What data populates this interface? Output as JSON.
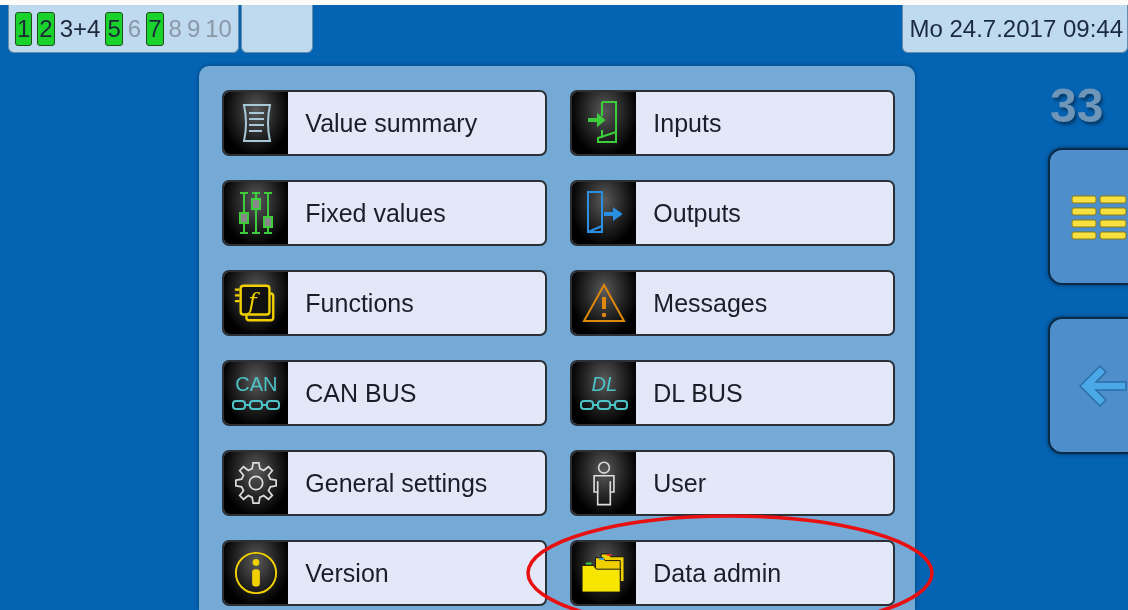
{
  "status_bar": {
    "channels": [
      {
        "label": "1",
        "active": true,
        "disabled": false
      },
      {
        "label": "2",
        "active": true,
        "disabled": false
      },
      {
        "label": "3+4",
        "active": false,
        "disabled": false
      },
      {
        "label": "5",
        "active": true,
        "disabled": false
      },
      {
        "label": "6",
        "active": false,
        "disabled": true
      },
      {
        "label": "7",
        "active": true,
        "disabled": false
      },
      {
        "label": "8",
        "active": false,
        "disabled": true
      },
      {
        "label": "9",
        "active": false,
        "disabled": true
      },
      {
        "label": "10",
        "active": false,
        "disabled": true
      }
    ],
    "datetime": "Mo 24.7.2017 09:44"
  },
  "menu": {
    "items": [
      {
        "label": "Value summary",
        "kind": "list",
        "highlighted": false
      },
      {
        "label": "Inputs",
        "kind": "input",
        "highlighted": false
      },
      {
        "label": "Fixed values",
        "kind": "sliders",
        "highlighted": false
      },
      {
        "label": "Outputs",
        "kind": "output",
        "highlighted": false
      },
      {
        "label": "Functions",
        "kind": "function",
        "icon_text": "f",
        "highlighted": false
      },
      {
        "label": "Messages",
        "kind": "warning",
        "highlighted": false
      },
      {
        "label": "CAN BUS",
        "kind": "bus",
        "icon_text": "CAN",
        "highlighted": false
      },
      {
        "label": "DL BUS",
        "kind": "bus",
        "icon_text": "DL",
        "highlighted": false
      },
      {
        "label": "General settings",
        "kind": "gear",
        "highlighted": false
      },
      {
        "label": "User",
        "kind": "user",
        "highlighted": false
      },
      {
        "label": "Version",
        "kind": "info",
        "highlighted": false
      },
      {
        "label": "Data admin",
        "kind": "folder",
        "highlighted": true
      }
    ]
  },
  "side": {
    "value": "33"
  }
}
